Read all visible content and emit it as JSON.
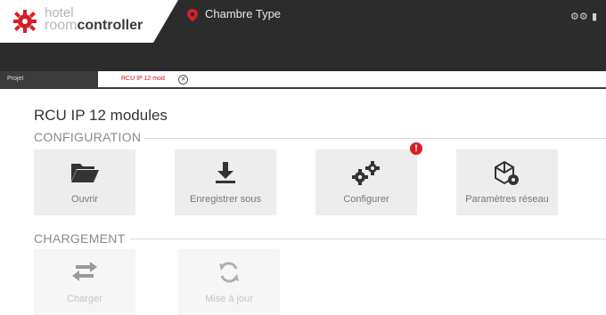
{
  "app": {
    "logo_line1": "hotel",
    "logo_room": "room",
    "logo_controller": "controller",
    "header_title": "Chambre Type",
    "brand_color": "#d81f26"
  },
  "tabs": [
    {
      "label": "Projet"
    },
    {
      "label": "RCU IP 12 mod"
    }
  ],
  "page": {
    "title": "RCU IP 12 modules"
  },
  "sections": {
    "configuration": {
      "label": "CONFIGURATION",
      "tiles": [
        {
          "label": "Ouvrir",
          "icon": "folder-open-icon"
        },
        {
          "label": "Enregistrer sous",
          "icon": "download-icon"
        },
        {
          "label": "Configurer",
          "icon": "gears-icon",
          "badge": "!"
        },
        {
          "label": "Paramètres réseau",
          "icon": "network-settings-icon"
        }
      ]
    },
    "chargement": {
      "label": "CHARGEMENT",
      "tiles": [
        {
          "label": "Charger",
          "icon": "transfer-arrows-icon",
          "disabled": true
        },
        {
          "label": "Mise à jour",
          "icon": "refresh-icon",
          "disabled": true
        }
      ]
    }
  }
}
